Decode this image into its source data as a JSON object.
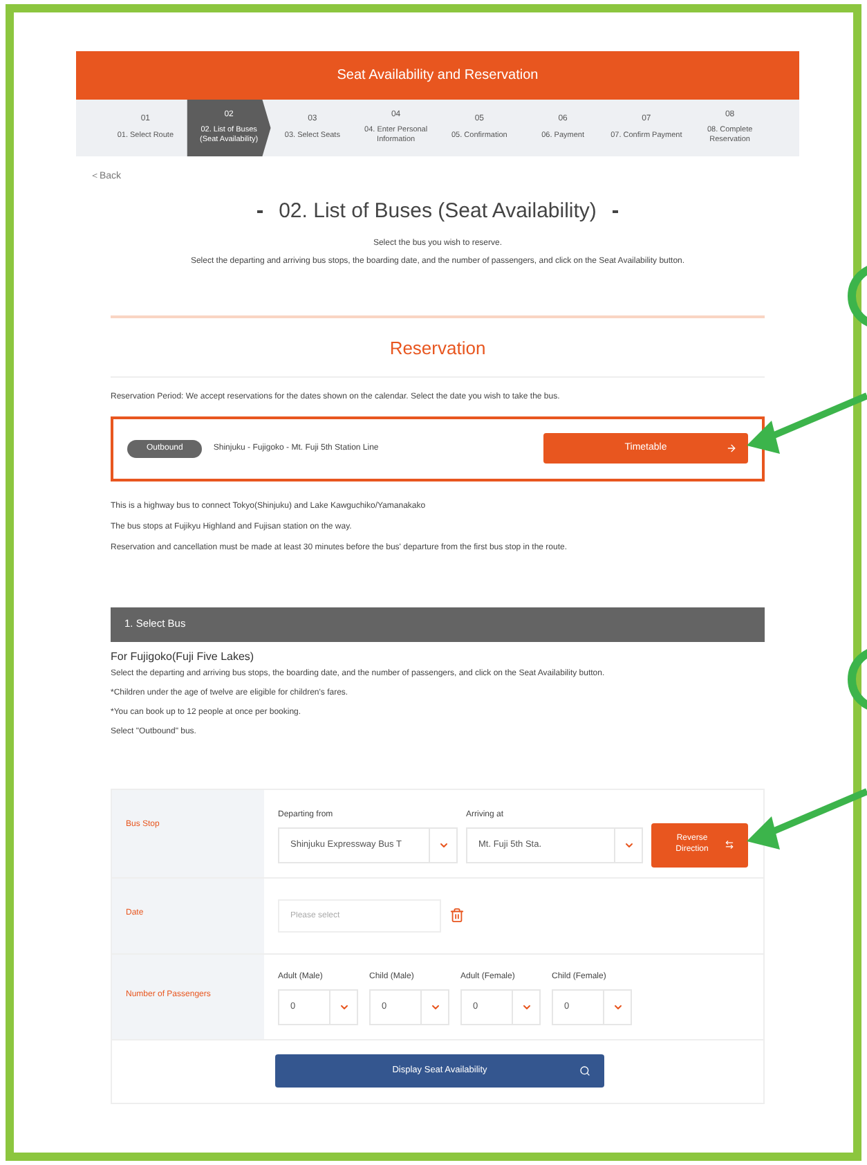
{
  "header": {
    "title": "Seat Availability and Reservation"
  },
  "steps": [
    {
      "number": "01",
      "label": "01. Select Route",
      "selected": false
    },
    {
      "number": "02",
      "label": "02. List of Buses (Seat Availability)",
      "selected": true
    },
    {
      "number": "03",
      "label": "03. Select Seats",
      "selected": false
    },
    {
      "number": "04",
      "label": "04. Enter Personal Information",
      "selected": false
    },
    {
      "number": "05",
      "label": "05. Confirmation",
      "selected": false
    },
    {
      "number": "06",
      "label": "06. Payment",
      "selected": false
    },
    {
      "number": "07",
      "label": "07. Confirm Payment",
      "selected": false
    },
    {
      "number": "08",
      "label": "08. Complete Reservation",
      "selected": false
    }
  ],
  "back_link": "＜Back",
  "page_title": "02. List of Buses (Seat Availability)",
  "intro": [
    "Select the bus you wish to reserve.",
    "Select the departing and arriving bus stops, the boarding date, and the number of passengers, and click on the Seat Availability button."
  ],
  "reservation": {
    "heading": "Reservation",
    "period_note": "Reservation Period: We accept reservations for the dates shown on the calendar. Select the date you wish to take the bus.",
    "route": {
      "badge": "Outbound",
      "name": "Shinjuku - Fujigoko - Mt. Fuji 5th Station Line",
      "button": "Timetable"
    },
    "notes": [
      "This is a highway bus to connect Tokyo(Shinjuku) and Lake Kawguchiko/Yamanakako",
      "The bus stops at Fujikyu Highland and Fujisan station on the way.",
      "Reservation and cancellation must be made at least 30 minutes before the bus' departure from the first bus stop in the route."
    ]
  },
  "select_bus": {
    "heading": "1. Select Bus",
    "subheading": "For Fujigoko(Fuji Five Lakes)",
    "notes": [
      "Select the departing and arriving bus stops, the boarding date, and the number of passengers, and click on the Seat Availability button.",
      "*Children under the age of twelve are eligible for children's fares.",
      "*You can book up to 12 people at once per booking.",
      "Select \"Outbound\" bus."
    ]
  },
  "form": {
    "bus_stop": {
      "label": "Bus Stop",
      "departing_label": "Departing from",
      "departing_value": "Shinjuku Expressway Bus T",
      "arriving_label": "Arriving at",
      "arriving_value": "Mt. Fuji 5th Sta.",
      "reverse_button": "Reverse Direction"
    },
    "date": {
      "label": "Date",
      "placeholder": "Please select"
    },
    "passengers": {
      "label": "Number of Passengers",
      "fields": [
        {
          "label": "Adult (Male)",
          "value": "0"
        },
        {
          "label": "Child (Male)",
          "value": "0"
        },
        {
          "label": "Adult (Female)",
          "value": "0"
        },
        {
          "label": "Child (Female)",
          "value": "0"
        }
      ]
    },
    "submit": "Display Seat Availability"
  }
}
